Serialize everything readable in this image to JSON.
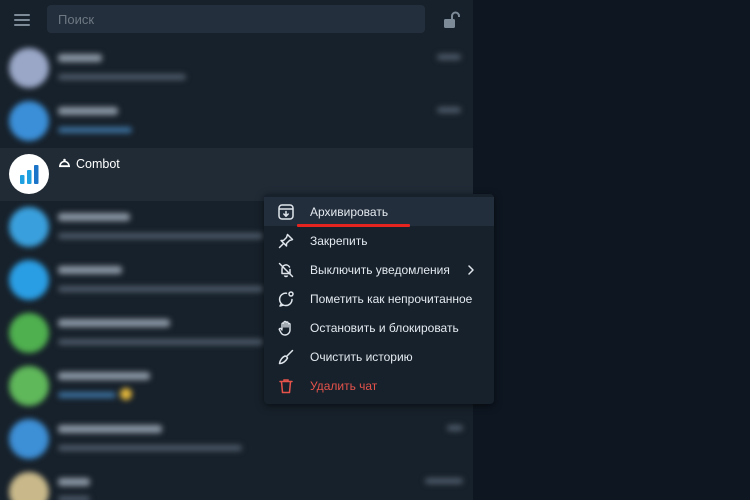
{
  "search": {
    "placeholder": "Поиск"
  },
  "chats": {
    "combot": {
      "name": "Combot"
    }
  },
  "context_menu": {
    "items": [
      {
        "label": "Архивировать",
        "icon": "archive-icon"
      },
      {
        "label": "Закрепить",
        "icon": "pin-icon"
      },
      {
        "label": "Выключить уведомления",
        "icon": "bell-off-icon"
      },
      {
        "label": "Пометить как непрочитанное",
        "icon": "mark-unread-icon"
      },
      {
        "label": "Остановить и блокировать",
        "icon": "hand-stop-icon"
      },
      {
        "label": "Очистить историю",
        "icon": "broom-icon"
      },
      {
        "label": "Удалить чат",
        "icon": "trash-icon"
      }
    ]
  },
  "colors": {
    "background": "#17212b",
    "selected_row": "#202b36",
    "danger": "#e5534b",
    "highlight_underline": "#e52420"
  }
}
